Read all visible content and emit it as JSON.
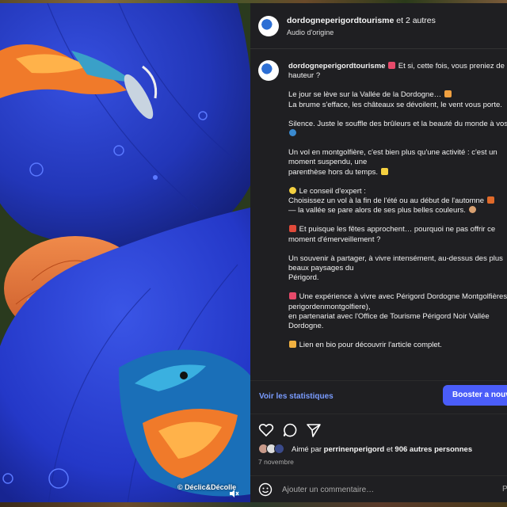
{
  "media": {
    "credit": "© Déclic&Décolle"
  },
  "header": {
    "username": "dordogneperigordtourisme",
    "coauthors": "et 2 autres",
    "audio": "Audio d'origine"
  },
  "caption": {
    "username": "dordogneperigordtourisme",
    "lines": [
      "Et si, cette fois, vous preniez de la",
      "hauteur ?",
      "Le jour se lève sur la Vallée de la Dordogne…",
      "La brume s'efface, les châteaux se dévoilent, le vent vous porte.",
      "Silence. Juste le souffle des brûleurs et la beauté du monde à vos pieds.",
      "Un vol en montgolfière, c'est bien plus qu'une activité : c'est un",
      "moment suspendu, une",
      "parenthèse hors du temps.",
      "Le conseil d'expert :",
      "Choisissez un vol à la fin de l'été ou au début de l'automne",
      "— la vallée se pare alors de ses plus belles couleurs.",
      "Et puisque les fêtes approchent… pourquoi ne pas offrir ce",
      "moment d'émerveillement ?",
      "Un souvenir à partager, à vivre intensément, au-dessus des plus",
      "beaux paysages du",
      "Périgord.",
      "Une expérience à vivre avec Périgord Dordogne Montgolfières (@",
      "perigordenmontgolfiere),",
      "en partenariat avec l'Office de Tourisme Périgord Noir Vallée",
      "Dordogne.",
      "Lien en bio pour découvrir l'article complet."
    ]
  },
  "stats": {
    "link": "Voir les statistiques",
    "boost": "Booster a nouveau"
  },
  "likes": {
    "prefix": "Aimé par",
    "user": "perrinenperigord",
    "middle": "et",
    "others": "906 autres personnes"
  },
  "date": "7 novembre",
  "comment": {
    "placeholder": "Ajouter un commentaire…",
    "post": "P"
  },
  "colors": {
    "panel_bg": "#1f1f22",
    "link": "#7a9cff",
    "boost": "#4a5df9",
    "balloon_blue": "#2438c8",
    "balloon_orange": "#f07a2a"
  },
  "icons": [
    "heart-icon",
    "comment-icon",
    "share-icon",
    "emoji-icon",
    "mute-icon"
  ]
}
